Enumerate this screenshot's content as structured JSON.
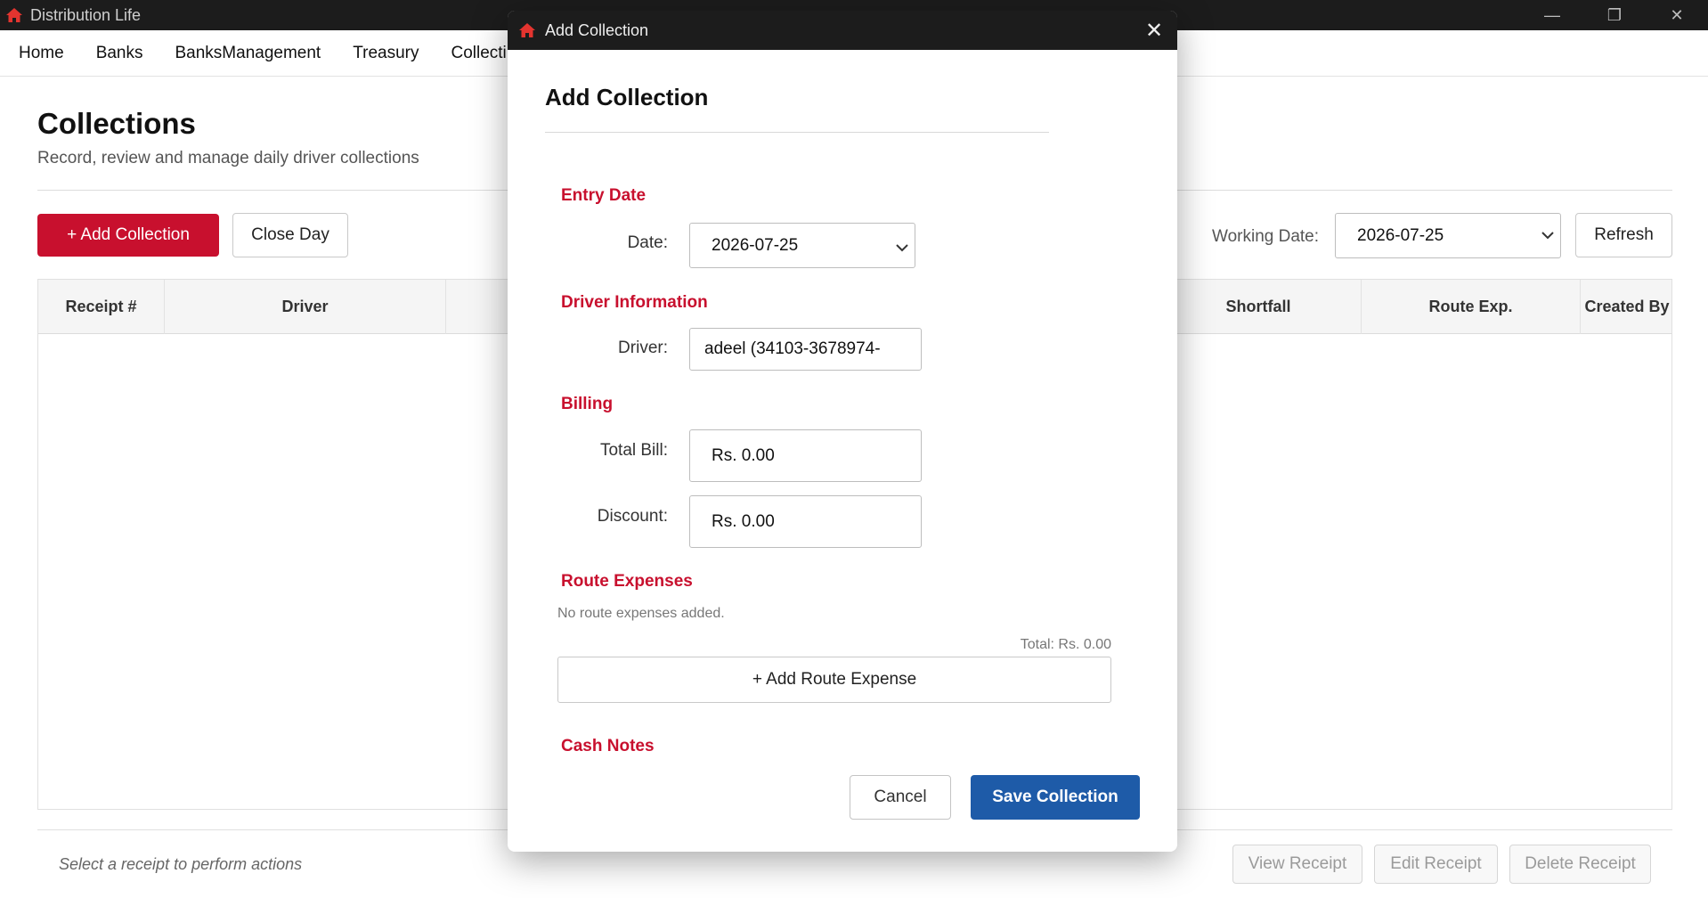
{
  "window": {
    "title": "Distribution Life",
    "controls": {
      "minimize": "—",
      "maximize": "❐",
      "close": "✕"
    }
  },
  "menu": {
    "items": [
      "Home",
      "Banks",
      "BanksManagement",
      "Treasury",
      "Collecti"
    ]
  },
  "page": {
    "title": "Collections",
    "subtitle": "Record, review and manage daily driver collections"
  },
  "toolbar": {
    "add_collection": "+ Add Collection",
    "close_day": "Close Day",
    "working_date_label": "Working Date:",
    "working_date_value": "2026-07-25",
    "refresh": "Refresh"
  },
  "table": {
    "columns": [
      "Receipt #",
      "Driver",
      "Shortfall",
      "Route Exp.",
      "Created By"
    ],
    "rows": []
  },
  "footer": {
    "hint": "Select a receipt to perform actions",
    "view_receipt": "View Receipt",
    "edit_receipt": "Edit Receipt",
    "delete_receipt": "Delete Receipt"
  },
  "modal": {
    "window_title": "Add Collection",
    "close": "✕",
    "heading": "Add Collection",
    "sections": {
      "entry_date": "Entry Date",
      "driver_info": "Driver Information",
      "billing": "Billing",
      "route_expenses": "Route Expenses",
      "cash_notes": "Cash Notes"
    },
    "fields": {
      "date_label": "Date:",
      "date_value": "2026-07-25",
      "driver_label": "Driver:",
      "driver_value": "adeel (34103-3678974-",
      "total_bill_label": "Total Bill:",
      "total_bill_value": "Rs. 0.00",
      "discount_label": "Discount:",
      "discount_value": "Rs. 0.00"
    },
    "route_expenses": {
      "empty_text": "No route expenses added.",
      "total": "Total: Rs. 0.00",
      "add_button": "+ Add Route Expense"
    },
    "buttons": {
      "cancel": "Cancel",
      "save": "Save Collection"
    }
  },
  "colors": {
    "accent_red": "#c8102e",
    "primary_blue": "#1e5ba8",
    "titlebar": "#1c1c1c"
  }
}
